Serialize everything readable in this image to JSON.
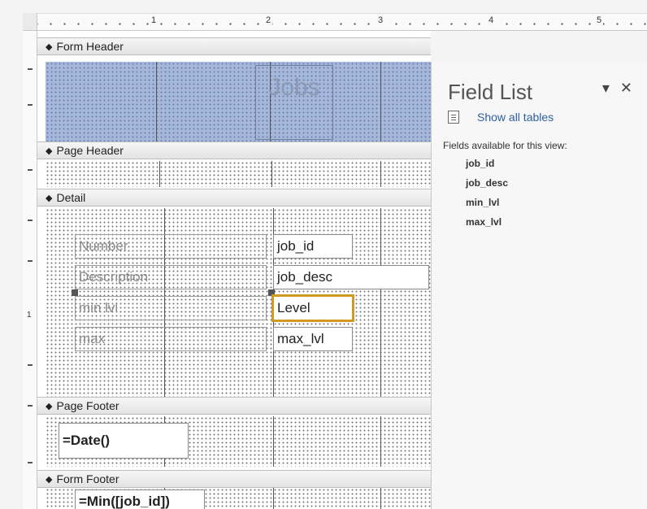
{
  "ruler": {
    "ticks": [
      "1",
      "2",
      "3",
      "4",
      "5"
    ],
    "side_tick": "1"
  },
  "sections": {
    "form_header": "Form Header",
    "page_header": "Page Header",
    "detail": "Detail",
    "page_footer": "Page Footer",
    "form_footer": "Form Footer"
  },
  "form_header": {
    "title": "Jobs"
  },
  "detail": {
    "labels": [
      "Number",
      "Description",
      "min lvl",
      "max"
    ],
    "fields": [
      "job_id",
      "job_desc",
      "Level",
      "max_lvl"
    ]
  },
  "page_footer": {
    "date_expr": "=Date()"
  },
  "form_footer": {
    "min_expr": "=Min([job_id])"
  },
  "field_list": {
    "title": "Field List",
    "dropdown_icon": "▾",
    "close_icon": "✕",
    "show_all": "Show all tables",
    "subheading": "Fields available for this view:",
    "fields": [
      "job_id",
      "job_desc",
      "min_lvl",
      "max_lvl"
    ]
  },
  "colors": {
    "header_blue": "#a5b8dc",
    "selection": "#d09a25",
    "link": "#2d5fa0"
  }
}
